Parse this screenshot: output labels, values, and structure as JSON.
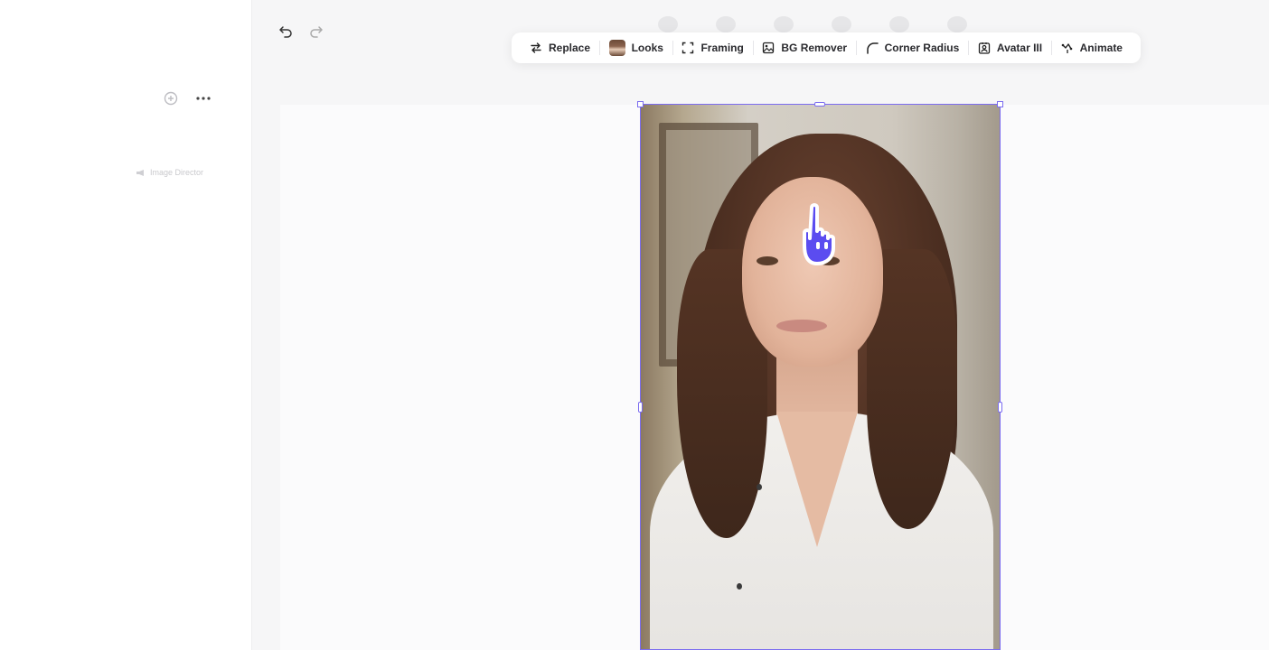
{
  "toolbar": {
    "items": [
      {
        "label": "Replace",
        "icon": "swap-arrows-icon"
      },
      {
        "label": "Looks",
        "icon": "looks-thumbnail"
      },
      {
        "label": "Framing",
        "icon": "framing-icon"
      },
      {
        "label": "BG Remover",
        "icon": "bg-remover-icon"
      },
      {
        "label": "Corner Radius",
        "icon": "corner-radius-icon"
      },
      {
        "label": "Avatar III",
        "icon": "avatar-icon"
      },
      {
        "label": "Animate",
        "icon": "animate-icon"
      }
    ]
  },
  "history": {
    "undo_icon": "undo-icon",
    "redo_icon": "redo-icon"
  },
  "left_panel": {
    "image_director_label": "Image Director",
    "actions": [
      "add-icon",
      "more-icon"
    ]
  },
  "canvas": {
    "selection_color": "#7b6cf0",
    "cursor_color": "#5b4cf0"
  }
}
